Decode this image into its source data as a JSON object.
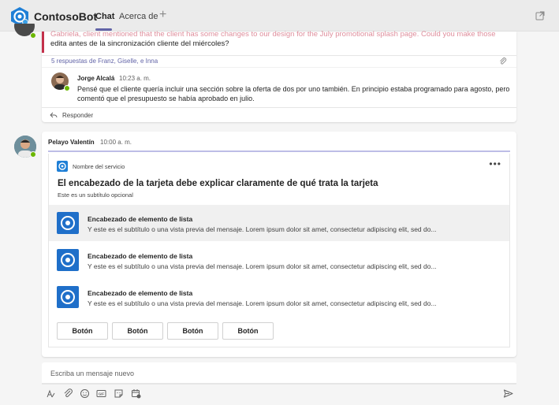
{
  "header": {
    "app_name": "ContosoBot",
    "tabs": [
      {
        "label": "Chat",
        "active": true
      },
      {
        "label": "Acerca de",
        "active": false
      }
    ],
    "add_tab_icon": "plus-icon",
    "popout_icon": "popout-icon"
  },
  "thread": {
    "cut_text": "Gabriela, client mentioned that the client has some changes to our design for the July promotional splash page. Could you make those",
    "body": "edita antes de la sincronización cliente del miércoles?",
    "replies_summary": "5 respuestas de Franz, Giselle, e Inna",
    "reply": {
      "author": "Jorge Alcalá",
      "time": "10:23 a. m.",
      "text": "Pensé que el cliente quería incluir una sección sobre la oferta de dos por uno también. En principio estaba programado para agosto, pero comentó que el presupuesto se había aprobado en julio."
    },
    "reply_link": "Responder"
  },
  "message": {
    "author": "Pelayo Valentín",
    "time": "10:00 a. m.",
    "card": {
      "service_name": "Nombre del servicio",
      "title": "El encabezado de la tarjeta debe explicar claramente de qué trata la tarjeta",
      "subtitle": "Este es un subtítulo opcional",
      "items": [
        {
          "heading": "Encabezado de elemento de lista",
          "preview": "Y este es el subtítulo o una vista previa del mensaje. Lorem ipsum dolor sit amet, consectetur adipiscing elit, sed do..."
        },
        {
          "heading": "Encabezado de elemento de lista",
          "preview": "Y este es el subtítulo o una vista previa del mensaje. Lorem ipsum dolor sit amet, consectetur adipiscing elit, sed do..."
        },
        {
          "heading": "Encabezado de elemento de lista",
          "preview": "Y este es el subtítulo o una vista previa del mensaje. Lorem ipsum dolor sit amet, consectetur adipiscing elit, sed do..."
        }
      ],
      "buttons": [
        "Botón",
        "Botón",
        "Botón",
        "Botón"
      ]
    }
  },
  "compose": {
    "placeholder": "Escriba un mensaje nuevo",
    "toolbar_icons": [
      "format-icon",
      "attach-icon",
      "emoji-icon",
      "gif-icon",
      "sticker-icon",
      "meet-icon"
    ],
    "send_icon": "send-icon"
  },
  "colors": {
    "accent": "#6264a7",
    "presence": "#6bb700",
    "alert_bar": "#c4314b",
    "card_icon": "#0f6cbd"
  }
}
